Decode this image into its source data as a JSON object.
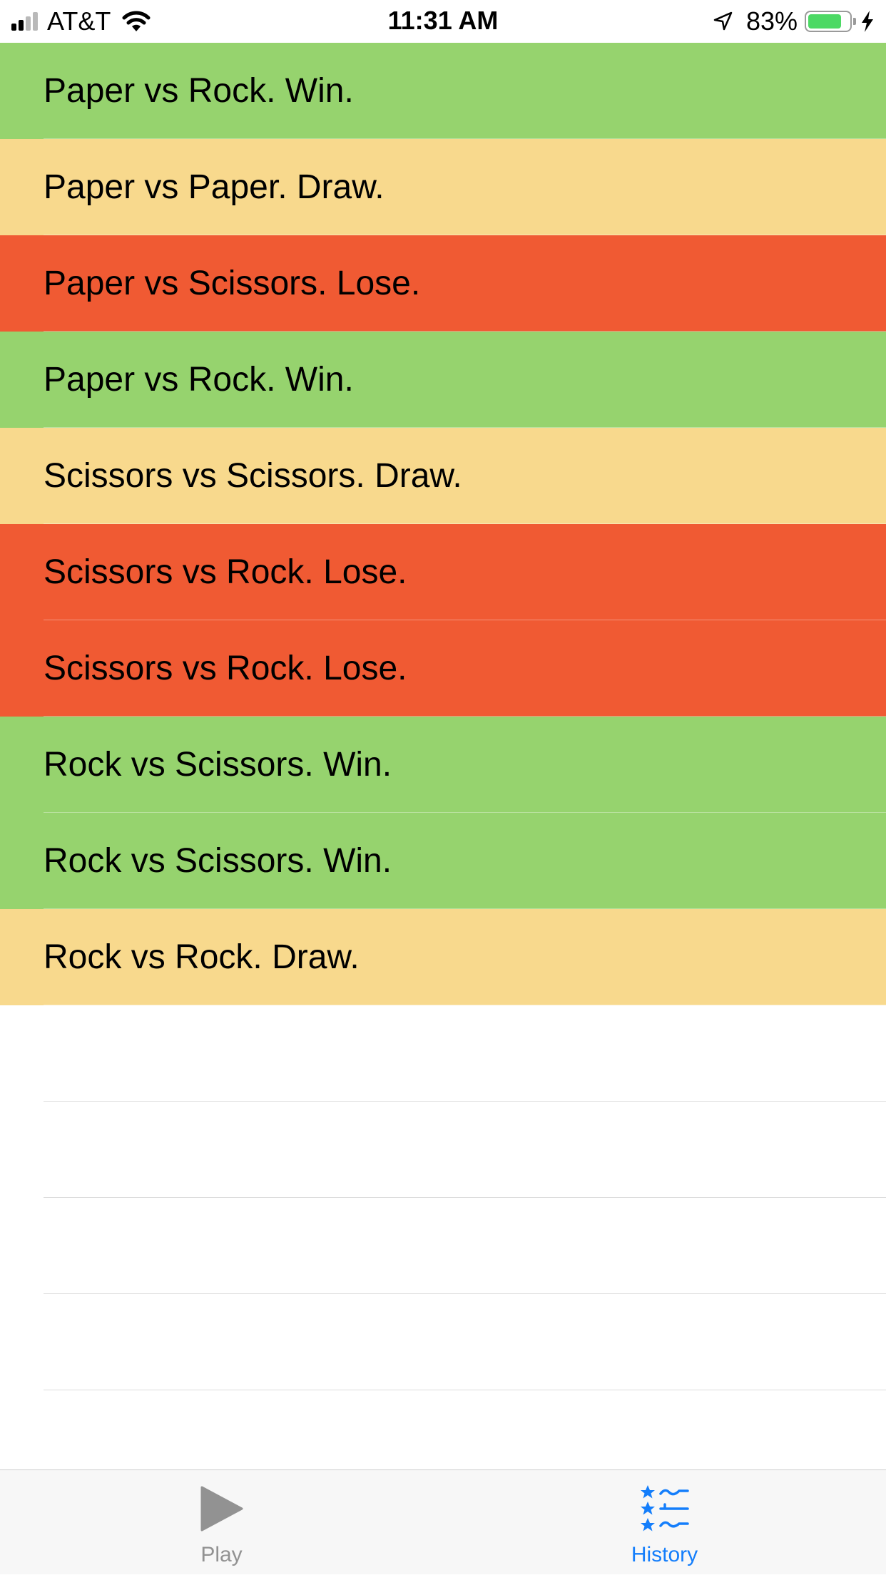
{
  "status_bar": {
    "carrier": "AT&T",
    "time": "11:31 AM",
    "battery_percent": "83%",
    "battery_level": 0.83,
    "signal_bars_filled": 2,
    "signal_bars_total": 4
  },
  "history": {
    "rows": [
      {
        "text": "Paper vs Rock. Win.",
        "result": "win"
      },
      {
        "text": "Paper vs Paper. Draw.",
        "result": "draw"
      },
      {
        "text": "Paper vs Scissors. Lose.",
        "result": "lose"
      },
      {
        "text": "Paper vs Rock. Win.",
        "result": "win"
      },
      {
        "text": "Scissors vs Scissors. Draw.",
        "result": "draw"
      },
      {
        "text": "Scissors vs Rock. Lose.",
        "result": "lose"
      },
      {
        "text": "Scissors vs Rock. Lose.",
        "result": "lose"
      },
      {
        "text": "Rock vs Scissors. Win.",
        "result": "win"
      },
      {
        "text": "Rock vs Scissors. Win.",
        "result": "win"
      },
      {
        "text": "Rock vs Rock. Draw.",
        "result": "draw"
      }
    ]
  },
  "colors": {
    "win": "#96d36e",
    "draw": "#f8d98d",
    "lose": "#f05a33",
    "tab_active": "#147efb",
    "tab_inactive": "#929292"
  },
  "tab_bar": {
    "tabs": [
      {
        "label": "Play",
        "icon": "play-icon",
        "active": false
      },
      {
        "label": "History",
        "icon": "history-list-icon",
        "active": true
      }
    ]
  }
}
